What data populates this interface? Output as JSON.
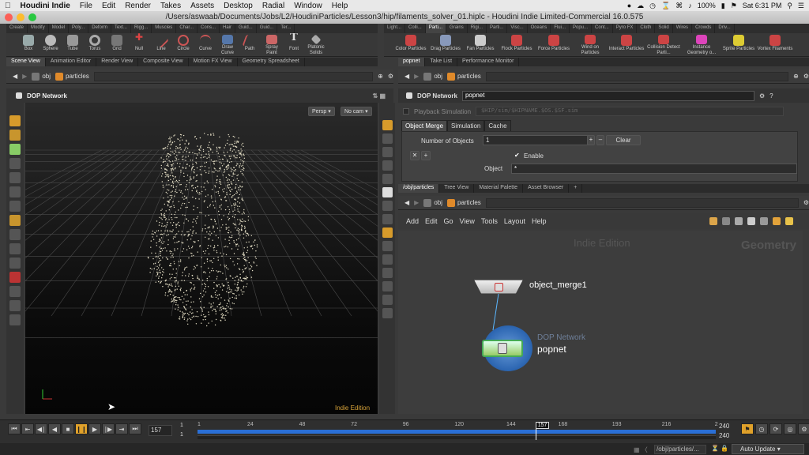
{
  "menubar": {
    "app": "Houdini Indie",
    "items": [
      "File",
      "Edit",
      "Render",
      "Takes",
      "Assets",
      "Desktop",
      "Radial",
      "Window",
      "Help"
    ],
    "battery": "100%",
    "clock": "Sat 6:31 PM"
  },
  "window": {
    "title": "/Users/aswaab/Documents/Jobs/L2/HoudiniParticles/Lesson3/hip/filaments_solver_01.hiplc - Houdini Indie Limited-Commercial 16.0.575"
  },
  "left_shelf": {
    "tabs": [
      "Create",
      "Modify",
      "Model",
      "Poly...",
      "Deform",
      "Text...",
      "Rigg...",
      "Muscles",
      "Char...",
      "Cons...",
      "Hair",
      "Guid...",
      "Guid...",
      "Ter..."
    ],
    "tools": [
      "Box",
      "Sphere",
      "Tube",
      "Torus",
      "Grid",
      "Null",
      "Line",
      "Circle",
      "Curve",
      "Draw Curve",
      "Path",
      "Spray Paint",
      "Font",
      "Platonic Solids"
    ]
  },
  "right_shelf": {
    "tabs": [
      "Light...",
      "Colli...",
      "Parti...",
      "Grains",
      "Rigi...",
      "Parti...",
      "Visc...",
      "Oceans",
      "Flui...",
      "Popu...",
      "Cont...",
      "Pyro FX",
      "Cloth",
      "Solid",
      "Wires",
      "Crowds",
      "Driv..."
    ],
    "tools": [
      "Color Particles",
      "Drag Particles",
      "Fan Particles",
      "Flock Particles",
      "Force Particles",
      "Wind on Particles",
      "Interact Particles",
      "Collision Detect Parti...",
      "Instance Geometry o...",
      "Sprite Particles",
      "Vortex Filaments"
    ]
  },
  "viewer": {
    "tabs": [
      "Scene View",
      "Animation Editor",
      "Render View",
      "Composite View",
      "Motion FX View",
      "Geometry Spreadsheet"
    ],
    "path": [
      "obj",
      "particles"
    ],
    "context_label": "DOP Network",
    "persp_btn": "Persp",
    "cam_btn": "No cam",
    "watermark": "Indie Edition"
  },
  "params": {
    "tabs": [
      "popnet",
      "Take List",
      "Performance Monitor"
    ],
    "path": [
      "obj",
      "particles"
    ],
    "node_type": "DOP Network",
    "node_name": "popnet",
    "playback_label": "Playback Simulation",
    "playback_path": "$HIP/sim/$HIPNAME.$OS.$SF.sim",
    "sub_tabs": [
      "Object Merge",
      "Simulation",
      "Cache"
    ],
    "num_objects_label": "Number of Objects",
    "num_objects_value": "1",
    "clear_btn": "Clear",
    "enable_label": "Enable",
    "object_label": "Object",
    "object_value": "*"
  },
  "network": {
    "tabs": [
      "/obj/particles",
      "Tree View",
      "Material Palette",
      "Asset Browser"
    ],
    "path": [
      "obj",
      "particles"
    ],
    "menu": [
      "Add",
      "Edit",
      "Go",
      "View",
      "Tools",
      "Layout",
      "Help"
    ],
    "watermark": "Indie Edition",
    "context": "Geometry",
    "node1": "object_merge1",
    "node2_type": "DOP Network",
    "node2_name": "popnet"
  },
  "timeline": {
    "current_frame": "157",
    "start_frame": "1",
    "start_frame2": "1",
    "end_frame": "240",
    "end_frame2": "240",
    "ticks": [
      "1",
      "24",
      "48",
      "72",
      "96",
      "120",
      "144",
      "157",
      "168",
      "193",
      "216",
      "2"
    ],
    "current_fraction": 0.652
  },
  "status": {
    "path": "/obj/particles/...",
    "auto_update": "Auto Update"
  },
  "colors": {
    "accent": "#f2a01c",
    "timeline_blue": "#2a6fd6",
    "node_blue": "#2c6cc0"
  }
}
